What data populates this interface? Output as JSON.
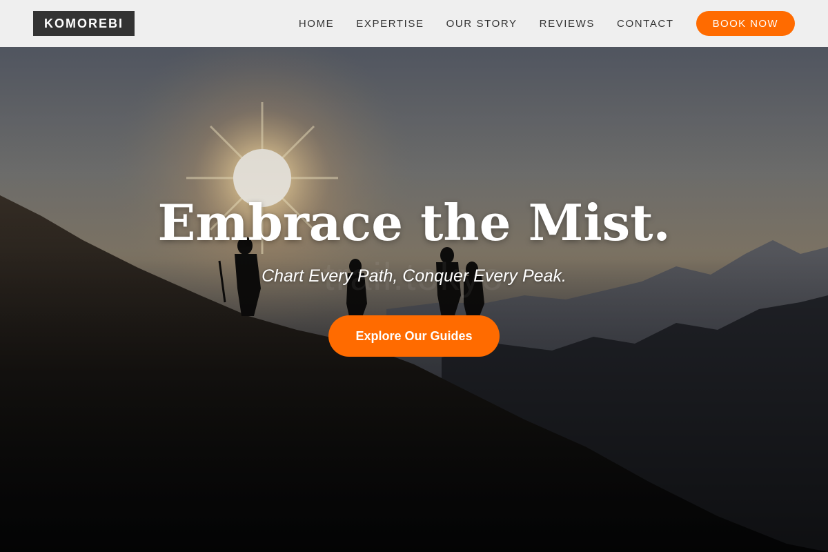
{
  "header": {
    "logo": "KOMOREBI",
    "nav": [
      "HOME",
      "EXPERTISE",
      "OUR STORY",
      "REVIEWS",
      "CONTACT"
    ],
    "book_label": "BOOK NOW"
  },
  "hero": {
    "title": "Embrace the Mist.",
    "subtitle": "Chart Every Path, Conquer Every Peak.",
    "cta_label": "Explore Our Guides",
    "watermark": "trail.tokyo",
    "image": "hikers-silhouette-sunrise-mountains"
  },
  "colors": {
    "accent": "#ff6b00",
    "header_bg": "#efefef",
    "logo_bg": "#333333",
    "nav_text": "#333333"
  }
}
